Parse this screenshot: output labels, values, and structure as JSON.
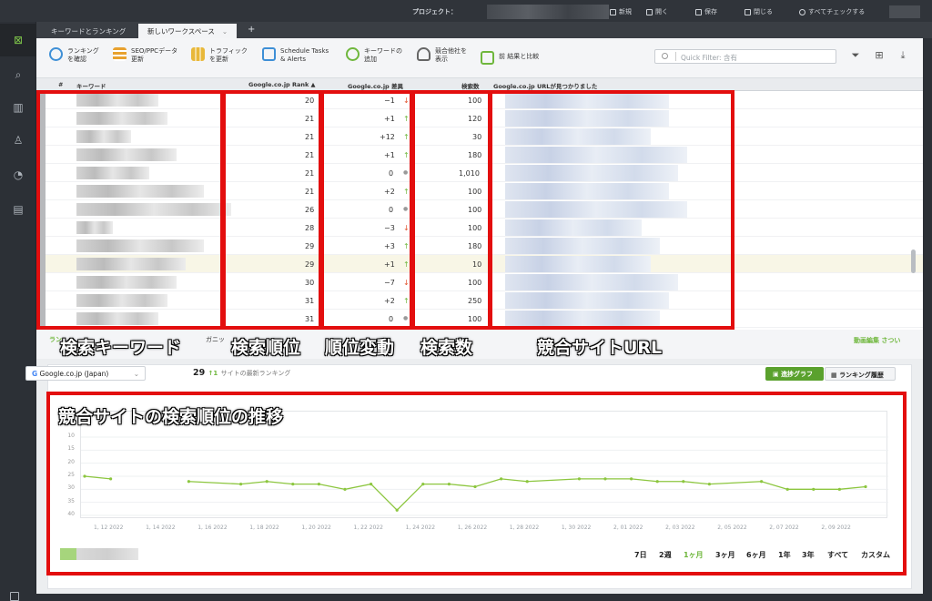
{
  "titlebar": {
    "project_label": "プロジェクト：",
    "actions": [
      "新規",
      "開く",
      "保存",
      "閉じる",
      "すべてチェックする"
    ]
  },
  "tabs": [
    {
      "label": "キーワードとランキング"
    },
    {
      "label": "新しいワークスペース",
      "close": "⌄"
    }
  ],
  "tab_add": "+",
  "toolbar": {
    "buttons": [
      {
        "label": "ランキング\nを確認",
        "color": "#3e8fd6"
      },
      {
        "label": "SEO/PPCデータ\n更新",
        "color": "#e8a12e"
      },
      {
        "label": "トラフィック\nを更新",
        "color": "#e8b83a"
      },
      {
        "label": "Schedule Tasks\n& Alerts",
        "color": "#3e8fd6"
      },
      {
        "label": "キーワードの\n追加",
        "color": "#6fb73d"
      },
      {
        "label": "競合他社を\n表示",
        "color": "#666666"
      },
      {
        "label": "前 結果と比較",
        "color": "#6fb73d"
      }
    ],
    "quick_filter_placeholder": "Quick Filter: 含有"
  },
  "table": {
    "headers": {
      "num": "#",
      "keyword": "キーワード",
      "rank": "Google.co.jp Rank ▲",
      "diff": "Google.co.jp 差異",
      "volume": "検索数",
      "url": "Google.co.jp URLが見つかりました"
    },
    "rows": [
      {
        "rank": "20",
        "diff": "−1",
        "dir": "down",
        "volume": "100"
      },
      {
        "rank": "21",
        "diff": "+1",
        "dir": "up",
        "volume": "120"
      },
      {
        "rank": "21",
        "diff": "+12",
        "dir": "up",
        "volume": "30"
      },
      {
        "rank": "21",
        "diff": "+1",
        "dir": "up",
        "volume": "180"
      },
      {
        "rank": "21",
        "diff": "0",
        "dir": "none",
        "volume": "1,010"
      },
      {
        "rank": "21",
        "diff": "+2",
        "dir": "up",
        "volume": "100"
      },
      {
        "rank": "26",
        "diff": "0",
        "dir": "none",
        "volume": "100"
      },
      {
        "rank": "28",
        "diff": "−3",
        "dir": "down",
        "volume": "100"
      },
      {
        "rank": "29",
        "diff": "+3",
        "dir": "up",
        "volume": "180"
      },
      {
        "rank": "29",
        "diff": "+1",
        "dir": "up",
        "volume": "10",
        "highlight": true
      },
      {
        "rank": "30",
        "diff": "−7",
        "dir": "down",
        "volume": "100"
      },
      {
        "rank": "31",
        "diff": "+2",
        "dir": "up",
        "volume": "250"
      },
      {
        "rank": "31",
        "diff": "0",
        "dir": "none",
        "volume": "100"
      }
    ]
  },
  "annotations": {
    "keyword": "検索キーワード",
    "rank": "検索順位",
    "diff": "順位変動",
    "volume": "検索数",
    "url": "競合サイトURL",
    "chart": "競合サイトの検索順位の推移"
  },
  "bottom": {
    "tab_partial": "ラン",
    "tab2_partial": "ガニッ",
    "right_link": "動画編集 さつい",
    "engine_select": "Google.co.jp (Japan)",
    "rank_value": "29",
    "rank_change": "↑1",
    "rank_caption": "サイトの最新ランキング",
    "btn_progress": "進捗グラフ",
    "btn_history": "ランキング履歴",
    "periods": [
      "7日",
      "2週",
      "1ヶ月",
      "3ヶ月",
      "6ヶ月",
      "1年",
      "3年",
      "すべて",
      "カスタム"
    ],
    "active_period": "1ヶ月"
  },
  "chart_data": {
    "type": "line",
    "yticks": [
      "10",
      "15",
      "20",
      "25",
      "30",
      "35",
      "40"
    ],
    "ylim": [
      10,
      40
    ],
    "y_inverted": true,
    "xticks": [
      "1, 12 2022",
      "1, 14 2022",
      "1, 16 2022",
      "1, 18 2022",
      "1, 20 2022",
      "1, 22 2022",
      "1, 24 2022",
      "1, 26 2022",
      "1, 28 2022",
      "1, 30 2022",
      "2, 01 2022",
      "2, 03 2022",
      "2, 05 2022",
      "2, 07 2022",
      "2, 09 2022"
    ],
    "series": [
      {
        "color": "#8cc63f",
        "segments": [
          [
            [
              0,
              25
            ],
            [
              1,
              26
            ]
          ],
          [
            [
              4,
              27
            ],
            [
              6,
              28
            ],
            [
              7,
              27
            ],
            [
              8,
              28
            ],
            [
              9,
              28
            ],
            [
              10,
              30
            ],
            [
              11,
              28
            ],
            [
              12,
              38
            ],
            [
              13,
              28
            ],
            [
              14,
              28
            ],
            [
              15,
              29
            ],
            [
              16,
              26
            ],
            [
              17,
              27
            ],
            [
              19,
              26
            ],
            [
              20,
              26
            ],
            [
              21,
              26
            ],
            [
              22,
              27
            ],
            [
              23,
              27
            ],
            [
              24,
              28
            ],
            [
              26,
              27
            ],
            [
              27,
              30
            ],
            [
              28,
              30
            ],
            [
              29,
              30
            ],
            [
              30,
              29
            ]
          ]
        ]
      }
    ],
    "grid": true
  }
}
